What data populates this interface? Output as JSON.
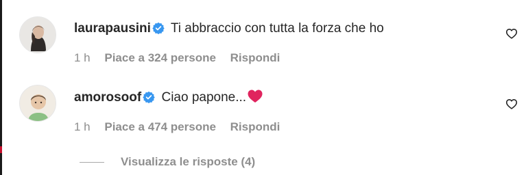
{
  "comments": [
    {
      "username": "laurapausini",
      "text": "Ti abbraccio con tutta la forza che ho",
      "time": "1 h",
      "likes": "Piace a 324 persone",
      "reply": "Rispondi"
    },
    {
      "username": "amorosoof",
      "text": "Ciao papone...",
      "emoji": "❤️",
      "time": "1 h",
      "likes": "Piace a 474 persone",
      "reply": "Rispondi"
    }
  ],
  "view_replies": "Visualizza le risposte (4)",
  "colors": {
    "verified": "#3897f0",
    "secondary_text": "#8e8e8e",
    "primary_text": "#262626",
    "emoji_heart": "#e0245e"
  },
  "icons": {
    "verified": "verified-badge-icon",
    "like": "heart-outline-icon"
  }
}
